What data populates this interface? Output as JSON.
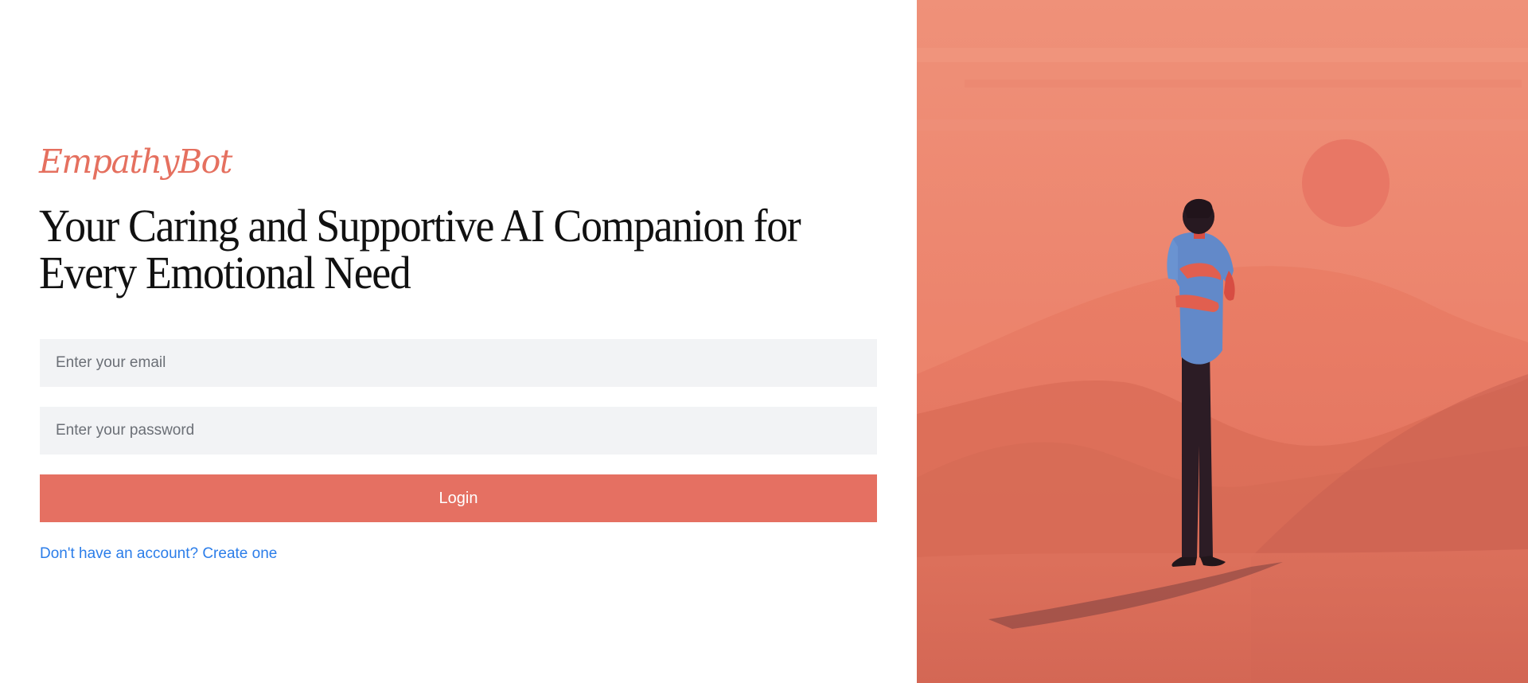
{
  "brand": {
    "name": "EmpathyBot"
  },
  "headline": "Your Caring and Supportive AI Companion for Every Emotional Need",
  "form": {
    "email_placeholder": "Enter your email",
    "password_placeholder": "Enter your password",
    "login_label": "Login",
    "signup_link": "Don't have an account? Create one"
  },
  "illustration": {
    "subject": "person-hugging-self-icon",
    "sun_icon": "sun-icon"
  },
  "colors": {
    "brand": "#e5705f",
    "button": "#e57062",
    "link": "#2b7de9",
    "input_bg": "#f2f3f5",
    "illustration_bg": "#ee8a72"
  }
}
